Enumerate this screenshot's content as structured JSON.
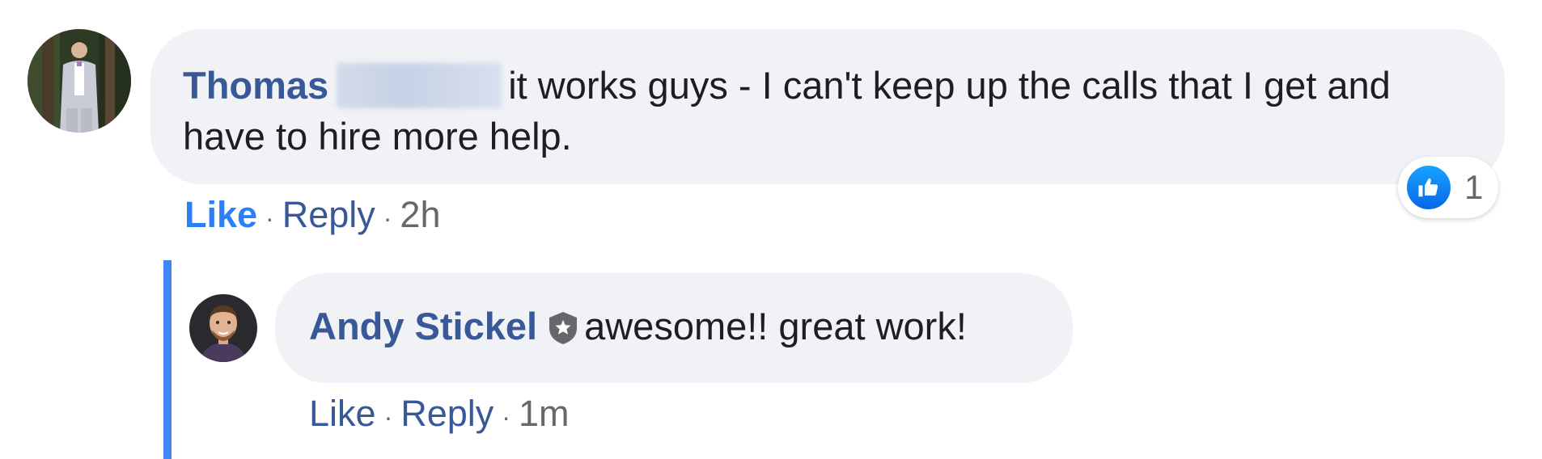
{
  "comment": {
    "author_first": "Thomas",
    "text": "it works guys - I can't keep up the calls that I get and have to hire more help.",
    "reaction_count": "1",
    "reaction_icon": "thumbs-up-icon",
    "actions": {
      "like": "Like",
      "reply": "Reply",
      "time": "2h",
      "separator": "·"
    }
  },
  "reply": {
    "author": "Andy Stickel",
    "badge_icon": "shield-star-icon",
    "text": "awesome!! great work!",
    "actions": {
      "like": "Like",
      "reply": "Reply",
      "time": "1m",
      "separator": "·"
    }
  },
  "colors": {
    "bubble": "#f0f2f5",
    "author": "#385898",
    "like_active": "#2d7ff9",
    "thread_line": "#4285f4",
    "meta": "#65676b"
  }
}
